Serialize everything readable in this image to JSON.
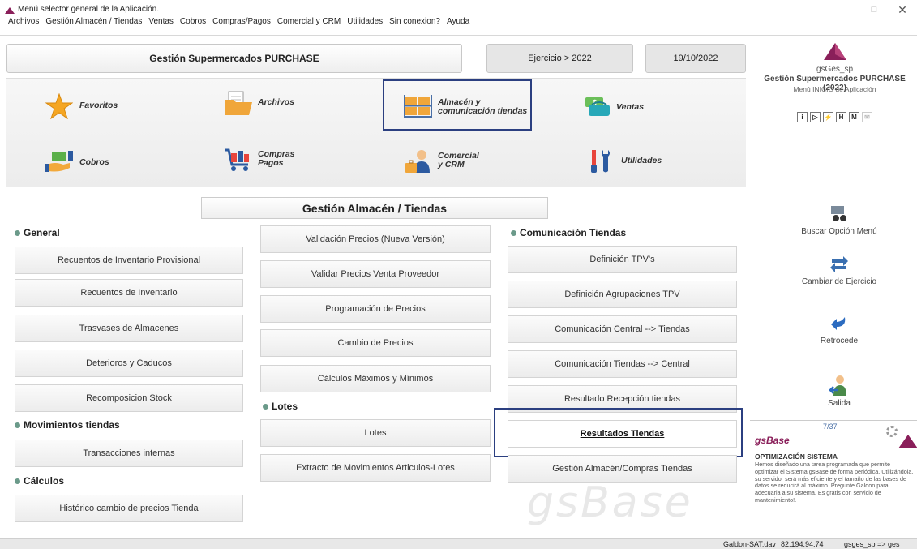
{
  "window": {
    "title": "Menú selector general de la Aplicación.",
    "minimize": "–",
    "maximize": "□",
    "close": "✕"
  },
  "menubar": [
    "Archivos",
    "Gestión Almacén / Tiendas",
    "Ventas",
    "Cobros",
    "Compras/Pagos",
    "Comercial y CRM",
    "Utilidades",
    "Sin conexion?",
    "Ayuda"
  ],
  "header": {
    "company": "Gestión Supermercados PURCHASE",
    "ejercicio": "Ejercicio > 2022",
    "date": "19/10/2022"
  },
  "main_menu": {
    "favoritos": "Favoritos",
    "archivos": "Archivos",
    "almacen": [
      "Almacén y",
      "comunicación tiendas"
    ],
    "ventas": "Ventas",
    "cobros": "Cobros",
    "compras": [
      "Compras",
      "Pagos"
    ],
    "comercial": [
      "Comercial",
      "y CRM"
    ],
    "utilidades": "Utilidades"
  },
  "section": {
    "title": "Gestión Almacén / Tiendas",
    "groups": {
      "general": "General",
      "movimientos": "Movimientos tiendas",
      "calculos": "Cálculos",
      "lotes": "Lotes",
      "comunicacion": "Comunicación Tiendas"
    },
    "general_items": [
      "Recuentos de Inventario Provisional",
      "Recuentos de Inventario",
      "Trasvases de Almacenes",
      "Deterioros y Caducos",
      "Recomposicion Stock"
    ],
    "movimientos_items": [
      "Transacciones internas"
    ],
    "calculos_items": [
      "Histórico cambio de precios Tienda"
    ],
    "precios_items": [
      "Validación Precios (Nueva Versión)",
      "Validar Precios Venta Proveedor",
      "Programación de Precios",
      "Cambio de Precios",
      "Cálculos Máximos y Mínimos"
    ],
    "lotes_items": [
      "Lotes",
      "Extracto de Movimientos Articulos-Lotes"
    ],
    "comunicacion_items": [
      "Definición TPV's",
      "Definición Agrupaciones TPV",
      "Comunicación Central --> Tiendas",
      "Comunicación Tiendas --> Central",
      "Resultado Recepción tiendas",
      "Resultados Tiendas",
      "Gestión Almacén/Compras Tiendas"
    ]
  },
  "watermark": "gsBase",
  "right_panel": {
    "app_code": "gsGes_sp",
    "company": "Gestión Supermercados PURCHASE (2022)",
    "menu_label": "Menú INICIO de Aplicación",
    "toolbar": [
      "i",
      "▷",
      "⚡",
      "H",
      "M",
      "✉"
    ],
    "buscar": "Buscar Opción Menú",
    "cambiar": "Cambiar de Ejercicio",
    "retrocede": "Retrocede",
    "salida": "Salida"
  },
  "info": {
    "counter": "7/37",
    "brand": "gsBase",
    "heading": "OPTIMIZACIÓN SISTEMA",
    "body": "Hemos diseñado una tarea programada que permite optimizar el Sistema gsBase de forma periódica. Utilizándola, su servidor será más eficiente y el tamaño de las bases de datos se reducirá al máximo. Pregunte Galdon para adecuarla a su sistema. Es gratis con servicio de mantenimiento!."
  },
  "status": {
    "server": "Galdon-SAT:dav",
    "ip": "82.194.94.74",
    "user": "gsges_sp => ges"
  },
  "colors": {
    "accent": "#8a1f5a",
    "selection_frame": "#2b3f80",
    "group_dot": "#6b9a8a"
  }
}
